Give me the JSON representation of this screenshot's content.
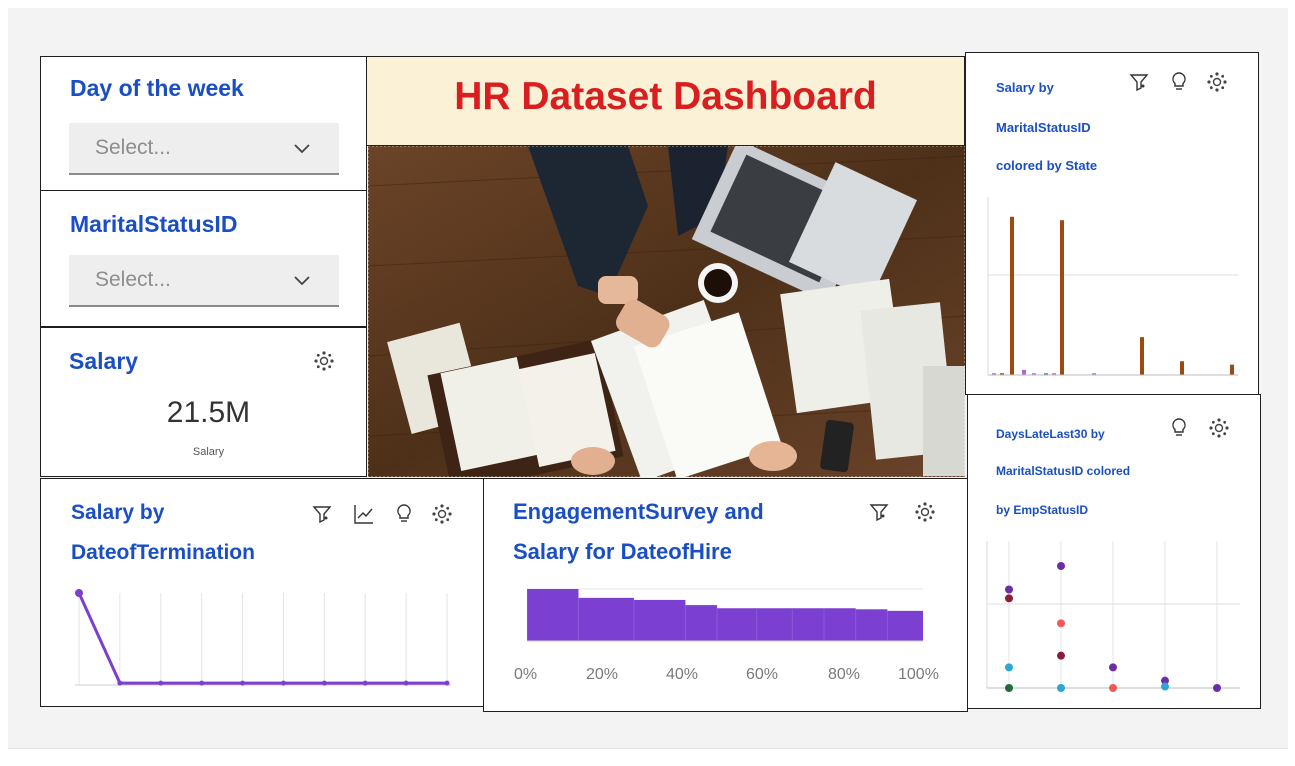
{
  "dashboard": {
    "title": "HR Dataset Dashboard",
    "title_color": "#d81e1e",
    "title_bg": "#fbf1d7",
    "accent_blue": "#1a4fc4",
    "series_purple": "#7b3fd1"
  },
  "filters": [
    {
      "label": "Day of the week",
      "placeholder": "Select...",
      "icon": "chevron-down-icon"
    },
    {
      "label": "MaritalStatusID",
      "placeholder": "Select...",
      "icon": "chevron-down-icon"
    }
  ],
  "kpi": {
    "title": "Salary",
    "value": "21.5M",
    "caption": "Salary",
    "icon": "settings-dots-icon"
  },
  "hero_image": {
    "icon": "office-desk-photo"
  },
  "widgets": {
    "salary_by_termination": {
      "title_line1": "Salary by",
      "title_line2": "DateofTermination",
      "icons": [
        "filter-icon",
        "trend-icon",
        "lightbulb-icon",
        "settings-dots-icon"
      ]
    },
    "engagement_salary": {
      "title_line1": "EngagementSurvey and",
      "title_line2": "Salary for DateofHire",
      "icons": [
        "filter-icon",
        "settings-dots-icon"
      ],
      "x_ticks": [
        "0%",
        "20%",
        "40%",
        "60%",
        "80%",
        "100%"
      ]
    },
    "salary_by_marital": {
      "title_line1": "Salary by",
      "title_line2": "MaritalStatusID",
      "title_line3": "colored by State",
      "icons": [
        "filter-icon",
        "lightbulb-icon",
        "settings-dots-icon"
      ]
    },
    "days_late": {
      "title_line1": "DaysLateLast30 by",
      "title_line2": "MaritalStatusID colored",
      "title_line3": "by EmpStatusID",
      "icons": [
        "lightbulb-icon",
        "settings-dots-icon"
      ]
    }
  },
  "chart_data": [
    {
      "type": "line",
      "id": "salary_by_termination",
      "title": "Salary by DateofTermination",
      "x": [
        1,
        2,
        3,
        4,
        5,
        6,
        7,
        8,
        9,
        10
      ],
      "values": [
        100,
        2,
        2,
        2,
        2,
        2,
        2,
        2,
        2,
        2
      ],
      "color": "#7b3fd1",
      "ylim": [
        0,
        100
      ],
      "grid": "vertical"
    },
    {
      "type": "bar",
      "id": "engagement_salary",
      "title": "EngagementSurvey and Salary for DateofHire",
      "orientation": "horizontal-stacked",
      "segments": [
        13,
        14,
        13,
        8,
        10,
        9,
        8,
        8,
        8,
        9
      ],
      "heights": [
        1.0,
        0.83,
        0.79,
        0.69,
        0.63,
        0.63,
        0.63,
        0.63,
        0.61,
        0.58
      ],
      "color": "#7b3fd1",
      "xlim": [
        0,
        100
      ],
      "x_unit": "%"
    },
    {
      "type": "bar",
      "id": "salary_by_marital",
      "title": "Salary by MaritalStatusID colored by State",
      "series": [
        {
          "color": "#9c4a0e",
          "values": [
            0,
            1,
            92,
            0,
            0,
            0,
            0,
            90,
            0,
            0,
            0,
            0,
            0,
            0,
            0,
            22,
            0,
            0,
            0,
            8,
            0,
            0,
            0,
            0,
            6
          ]
        },
        {
          "color": "#b06ad6",
          "values": [
            1,
            0,
            0,
            3,
            1,
            0,
            1,
            0,
            0,
            0,
            1,
            0,
            0,
            0,
            0,
            0,
            0,
            0,
            0,
            0,
            0,
            0,
            0,
            0,
            0
          ]
        },
        {
          "color": "#3a7bd5",
          "values": [
            0,
            0,
            0,
            0,
            0,
            1,
            0,
            0,
            0,
            0,
            0,
            0,
            0,
            0,
            0,
            0,
            0,
            0,
            0,
            0,
            0,
            0,
            0,
            0,
            0
          ]
        }
      ],
      "ylim": [
        0,
        100
      ],
      "grid": "one-horizontal-line"
    },
    {
      "type": "scatter",
      "id": "days_late",
      "title": "DaysLateLast30 by MaritalStatusID colored by EmpStatusID",
      "points": [
        {
          "x": 0,
          "y": 67,
          "color": "#6a2fa3"
        },
        {
          "x": 0,
          "y": 61,
          "color": "#8b1d3a"
        },
        {
          "x": 0,
          "y": 14,
          "color": "#2aa7d6"
        },
        {
          "x": 0,
          "y": 0,
          "color": "#1f6b3a"
        },
        {
          "x": 1,
          "y": 83,
          "color": "#6a2fa3"
        },
        {
          "x": 1,
          "y": 44,
          "color": "#ef5a5a"
        },
        {
          "x": 1,
          "y": 22,
          "color": "#8b1d3a"
        },
        {
          "x": 1,
          "y": 0,
          "color": "#2aa7d6"
        },
        {
          "x": 2,
          "y": 14,
          "color": "#6a2fa3"
        },
        {
          "x": 2,
          "y": 0,
          "color": "#ef5a5a"
        },
        {
          "x": 3,
          "y": 5,
          "color": "#6a2fa3"
        },
        {
          "x": 3,
          "y": 1,
          "color": "#2aa7d6"
        },
        {
          "x": 4,
          "y": 0,
          "color": "#6a2fa3"
        }
      ],
      "ylim": [
        0,
        100
      ],
      "grid": "vertical-and-one-horizontal"
    }
  ]
}
